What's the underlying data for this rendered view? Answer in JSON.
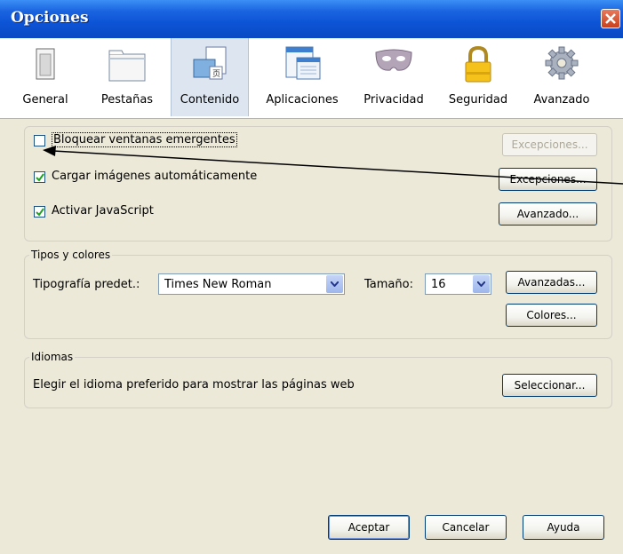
{
  "window": {
    "title": "Opciones"
  },
  "toolbar": {
    "tabs": [
      {
        "label": "General",
        "icon": "general-icon"
      },
      {
        "label": "Pestañas",
        "icon": "tabs-icon"
      },
      {
        "label": "Contenido",
        "icon": "content-icon",
        "selected": true
      },
      {
        "label": "Aplicaciones",
        "icon": "applications-icon"
      },
      {
        "label": "Privacidad",
        "icon": "privacy-mask-icon"
      },
      {
        "label": "Seguridad",
        "icon": "lock-icon"
      },
      {
        "label": "Avanzado",
        "icon": "gear-icon"
      }
    ]
  },
  "content": {
    "popups": {
      "label": "Bloquear ventanas emergentes",
      "checked": false,
      "button": "Excepciones..."
    },
    "images": {
      "label": "Cargar imágenes automáticamente",
      "checked": true,
      "button": "Excepciones..."
    },
    "javascript": {
      "label": "Activar JavaScript",
      "checked": true,
      "button": "Avanzado..."
    }
  },
  "fonts": {
    "group_label": "Tipos y colores",
    "font_label": "Tipografía predet.:",
    "font_value": "Times New Roman",
    "size_label": "Tamaño:",
    "size_value": "16",
    "advanced_button": "Avanzadas...",
    "colors_button": "Colores..."
  },
  "languages": {
    "group_label": "Idiomas",
    "description": "Elegir el idioma preferido para mostrar las páginas web",
    "select_button": "Seleccionar..."
  },
  "footer": {
    "ok": "Aceptar",
    "cancel": "Cancelar",
    "help": "Ayuda"
  },
  "colors": {
    "titlebar": "#0c54d6",
    "dialog_bg": "#ece9d8",
    "selected_tab": "#dde6f0",
    "check": "#21a121"
  }
}
